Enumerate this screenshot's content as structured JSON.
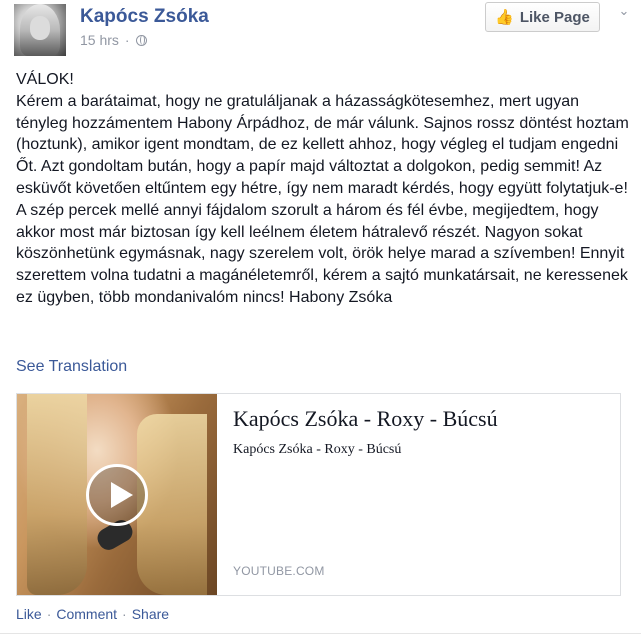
{
  "page": {
    "name": "Kapócs Zsóka",
    "timestamp": "15 hrs",
    "meta_separator": "·",
    "like_page_label": "Like Page",
    "menu_chevron": "⌄"
  },
  "post": {
    "heading": "VÁLOK!",
    "body": "Kérem a barátaimat, hogy ne gratuláljanak a házasságkötesemhez, mert ugyan tényleg hozzámentem Habony Árpádhoz, de már válunk. Sajnos rossz döntést hoztam (hoztunk), amikor igent mondtam, de ez kellett ahhoz, hogy végleg el tudjam engedni Őt. Azt gondoltam bután, hogy a papír majd változtat a dolgokon, pedig semmit! Az esküvőt követően eltűntem egy hétre, így nem maradt kérdés, hogy együtt folytatjuk-e! A szép percek mellé annyi fájdalom szorult a három és fél évbe, megijedtem, hogy akkor most már biztosan így kell leélnem életem hátralevő részét. Nagyon sokat köszönhetünk egymásnak, nagy szerelem volt, örök helye marad a szívemben! Ennyit szerettem volna tudatni a magánéletemről, kérem a sajtó munkatársait, ne keressenek ez ügyben, több mondanivalóm nincs! Habony Zsóka",
    "see_translation": "See Translation"
  },
  "link_card": {
    "title": "Kapócs Zsóka - Roxy - Búcsú",
    "description": "Kapócs Zsóka - Roxy - Búcsú",
    "source": "YOUTUBE.COM"
  },
  "actions": {
    "like": "Like",
    "comment": "Comment",
    "share": "Share",
    "separator": "·"
  },
  "icons": {
    "like_page_icon": "thumbs-up-icon",
    "privacy_icon": "globe-icon",
    "video_icon": "play-icon"
  },
  "colors": {
    "brand_link": "#3b5998",
    "meta_gray": "#9197a3",
    "text": "#141823"
  }
}
